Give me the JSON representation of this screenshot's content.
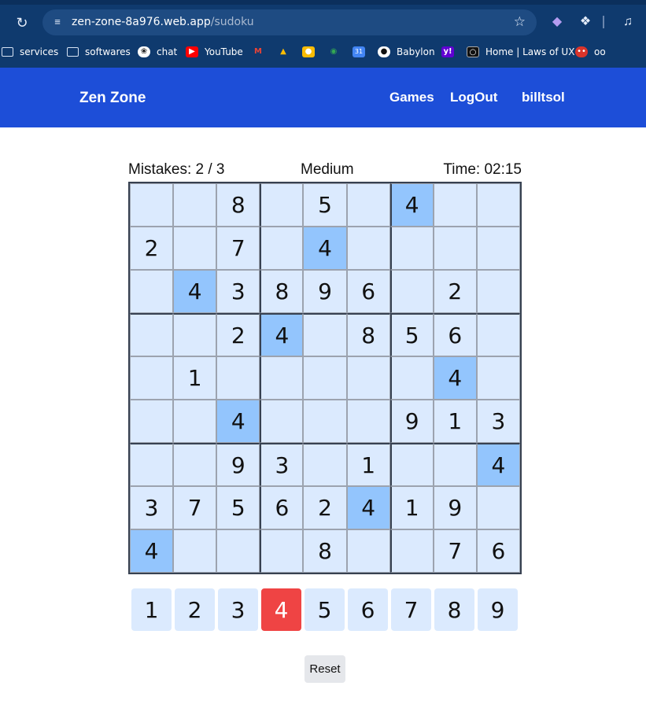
{
  "browser": {
    "url_host": "zen-zone-8a976.web.app",
    "url_path": "/sudoku",
    "bookmarks": [
      {
        "label": "services",
        "icon": "folder-icon"
      },
      {
        "label": "softwares",
        "icon": "folder-icon"
      },
      {
        "label": "chat",
        "icon": "chatgpt-icon"
      },
      {
        "label": "YouTube",
        "icon": "youtube-icon"
      },
      {
        "label": "",
        "icon": "gmail-icon"
      },
      {
        "label": "",
        "icon": "drive-icon"
      },
      {
        "label": "",
        "icon": "keep-icon"
      },
      {
        "label": "",
        "icon": "maps-icon"
      },
      {
        "label": "",
        "icon": "calendar-icon"
      },
      {
        "label": "Babylon",
        "icon": "github-icon"
      },
      {
        "label": "",
        "icon": "yahoo-icon"
      },
      {
        "label": "Home | Laws of UX",
        "icon": "lawsofux-icon"
      },
      {
        "label": "oo",
        "icon": "owl-icon"
      }
    ]
  },
  "header": {
    "brand": "Zen Zone",
    "nav": [
      "Games",
      "LogOut",
      "billtsol"
    ]
  },
  "game": {
    "mistakes": "Mistakes: 2 / 3",
    "difficulty": "Medium",
    "timer": "Time: 02:15",
    "board": [
      [
        "",
        "",
        "8",
        "",
        "5",
        "",
        "4",
        "",
        ""
      ],
      [
        "2",
        "",
        "7",
        "",
        "4",
        "",
        "",
        "",
        ""
      ],
      [
        "",
        "4",
        "3",
        "8",
        "9",
        "6",
        "",
        "2",
        ""
      ],
      [
        "",
        "",
        "2",
        "4",
        "",
        "8",
        "5",
        "6",
        ""
      ],
      [
        "",
        "1",
        "",
        "",
        "",
        "",
        "",
        "4",
        ""
      ],
      [
        "",
        "",
        "4",
        "",
        "",
        "",
        "9",
        "1",
        "3"
      ],
      [
        "",
        "",
        "9",
        "3",
        "",
        "1",
        "",
        "",
        "4"
      ],
      [
        "3",
        "7",
        "5",
        "6",
        "2",
        "4",
        "1",
        "9",
        ""
      ],
      [
        "4",
        "",
        "",
        "",
        "8",
        "",
        "",
        "7",
        "6"
      ]
    ],
    "selected_number": "4",
    "numpad": [
      "1",
      "2",
      "3",
      "4",
      "5",
      "6",
      "7",
      "8",
      "9"
    ],
    "reset_label": "Reset"
  },
  "colors": {
    "header_bg": "#1d4ed8",
    "cell_bg": "#dbeafe",
    "highlight_bg": "#93c5fd",
    "active_number_bg": "#ef4444"
  }
}
